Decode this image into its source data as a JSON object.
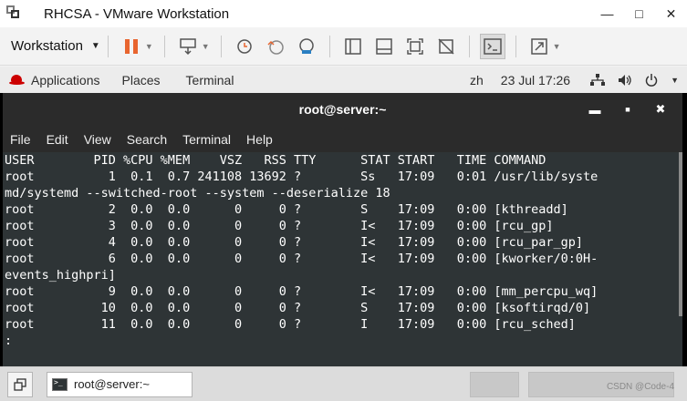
{
  "window": {
    "title": "RHCSA - VMware Workstation"
  },
  "toolbar": {
    "menu_label": "Workstation"
  },
  "gnome": {
    "applications": "Applications",
    "places": "Places",
    "terminal": "Terminal",
    "lang": "zh",
    "datetime": "23 Jul  17:26"
  },
  "terminal": {
    "title": "root@server:~",
    "menu": [
      "File",
      "Edit",
      "View",
      "Search",
      "Terminal",
      "Help"
    ],
    "lines": [
      "USER        PID %CPU %MEM    VSZ   RSS TTY      STAT START   TIME COMMAND",
      "root          1  0.1  0.7 241108 13692 ?        Ss   17:09   0:01 /usr/lib/syste",
      "md/systemd --switched-root --system --deserialize 18",
      "root          2  0.0  0.0      0     0 ?        S    17:09   0:00 [kthreadd]",
      "root          3  0.0  0.0      0     0 ?        I<   17:09   0:00 [rcu_gp]",
      "root          4  0.0  0.0      0     0 ?        I<   17:09   0:00 [rcu_par_gp]",
      "root          6  0.0  0.0      0     0 ?        I<   17:09   0:00 [kworker/0:0H-",
      "events_highpri]",
      "root          9  0.0  0.0      0     0 ?        I<   17:09   0:00 [mm_percpu_wq]",
      "root         10  0.0  0.0      0     0 ?        S    17:09   0:00 [ksoftirqd/0]",
      "root         11  0.0  0.0      0     0 ?        I    17:09   0:00 [rcu_sched]",
      ":"
    ]
  },
  "taskbar": {
    "task_label": "root@server:~"
  },
  "watermark": "CSDN @Code-4",
  "colors": {
    "terminal_bg": "#2e3436",
    "gnome_bar": "#ececec",
    "pause": "#e8652f"
  }
}
